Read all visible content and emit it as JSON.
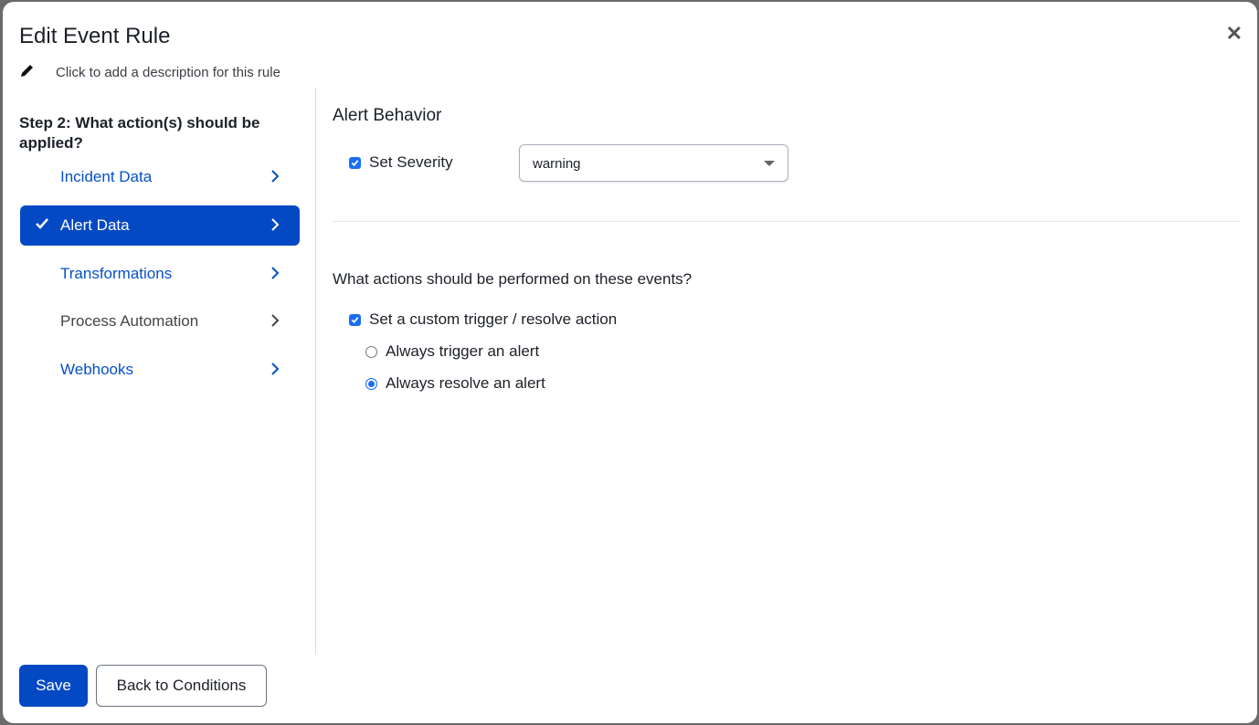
{
  "modal": {
    "title": "Edit Event Rule",
    "description_placeholder": "Click to add a description for this rule"
  },
  "sidebar": {
    "step_heading": "Step 2: What action(s) should be applied?",
    "items": [
      {
        "label": "Incident Data",
        "state": "link"
      },
      {
        "label": "Alert Data",
        "state": "active"
      },
      {
        "label": "Transformations",
        "state": "link"
      },
      {
        "label": "Process Automation",
        "state": "disabled"
      },
      {
        "label": "Webhooks",
        "state": "link"
      }
    ]
  },
  "main": {
    "section_title": "Alert Behavior",
    "set_severity_label": "Set Severity",
    "set_severity_checked": true,
    "severity_value": "warning",
    "actions_question": "What actions should be performed on these events?",
    "custom_action_label": "Set a custom trigger / resolve action",
    "custom_action_checked": true,
    "radio_options": [
      {
        "label": "Always trigger an alert",
        "selected": false
      },
      {
        "label": "Always resolve an alert",
        "selected": true
      }
    ]
  },
  "footer": {
    "save_label": "Save",
    "back_label": "Back to Conditions"
  },
  "colors": {
    "accent": "#0449c4",
    "checkbox": "#1a6ef5"
  }
}
